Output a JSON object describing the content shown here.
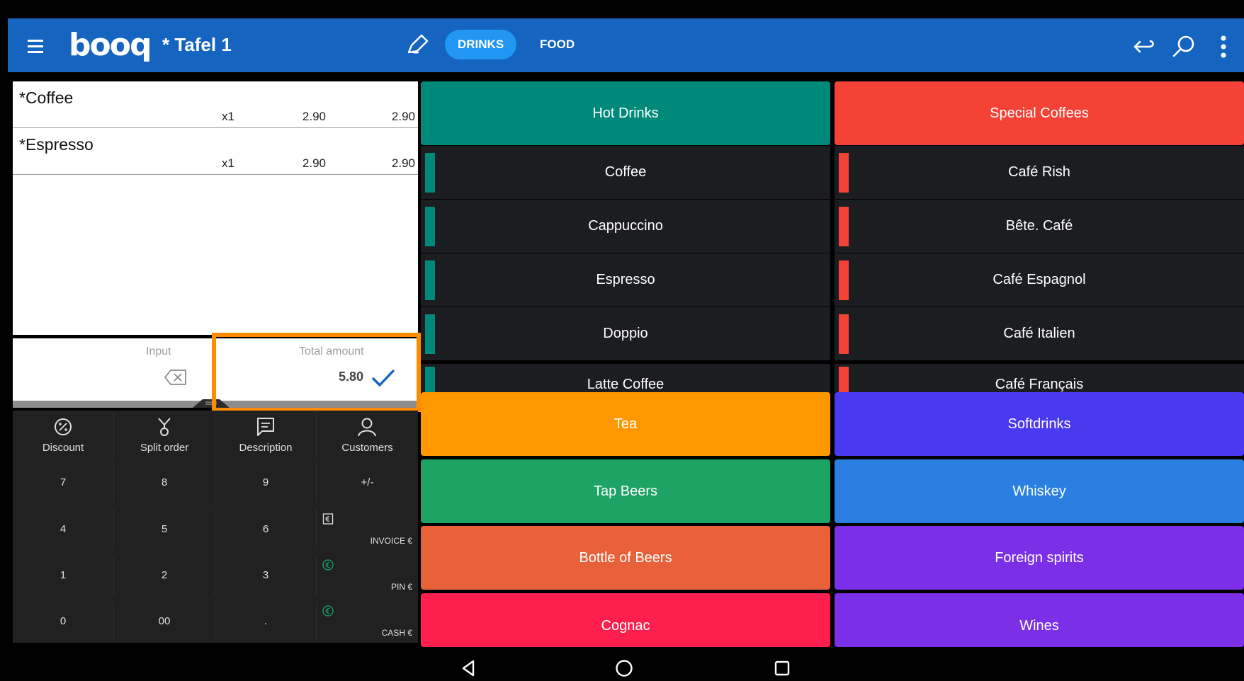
{
  "header": {
    "logo": "booq",
    "table_title": "* Tafel 1",
    "tabs": [
      {
        "label": "DRINKS",
        "active": true
      },
      {
        "label": "FOOD",
        "active": false
      }
    ],
    "bar_color": "#1565c0",
    "active_tab_color": "#2196f3"
  },
  "order": {
    "lines": [
      {
        "name": "*Coffee",
        "qty": "x1",
        "price": "2.90",
        "total": "2.90"
      },
      {
        "name": "*Espresso",
        "qty": "x1",
        "price": "2.90",
        "total": "2.90"
      }
    ]
  },
  "input": {
    "input_label": "Input",
    "total_label": "Total amount",
    "total_value": "5.80"
  },
  "actions": [
    {
      "label": "Discount",
      "icon": "discount-icon"
    },
    {
      "label": "Split order",
      "icon": "split-icon"
    },
    {
      "label": "Description",
      "icon": "description-icon"
    },
    {
      "label": "Customers",
      "icon": "customer-icon"
    }
  ],
  "keypad": {
    "rows": [
      [
        "7",
        "8",
        "9",
        "+/-"
      ],
      [
        "4",
        "5",
        "6"
      ],
      [
        "1",
        "2",
        "3"
      ],
      [
        "0",
        "00",
        "."
      ]
    ],
    "payments": [
      {
        "label": "INVOICE €",
        "icon": "invoice-icon"
      },
      {
        "label": "PIN €",
        "icon": "euro-icon"
      },
      {
        "label": "CASH €",
        "icon": "euro-icon"
      }
    ]
  },
  "categories_top": [
    {
      "label": "Hot Drinks",
      "color": "#00897b"
    },
    {
      "label": "Special Coffees",
      "color": "#f44336"
    }
  ],
  "products_left": [
    {
      "label": "Coffee",
      "stripe": "#00897b"
    },
    {
      "label": "Cappuccino",
      "stripe": "#00897b"
    },
    {
      "label": "Espresso",
      "stripe": "#00897b"
    },
    {
      "label": "Doppio",
      "stripe": "#00897b"
    },
    {
      "label": "Latte Coffee",
      "stripe": "#00897b"
    }
  ],
  "products_right": [
    {
      "label": "Café Rish",
      "stripe": "#f44336"
    },
    {
      "label": "Bête. Café",
      "stripe": "#f44336"
    },
    {
      "label": "Café Espagnol",
      "stripe": "#f44336"
    },
    {
      "label": "Café Italien",
      "stripe": "#f44336"
    },
    {
      "label": "Café Français",
      "stripe": "#f44336"
    }
  ],
  "categories": [
    {
      "left": {
        "label": "Tea",
        "color": "#ff9800"
      },
      "right": {
        "label": "Softdrinks",
        "color": "#4a3aef"
      }
    },
    {
      "left": {
        "label": "Tap Beers",
        "color": "#1da363"
      },
      "right": {
        "label": "Whiskey",
        "color": "#2a80e0"
      }
    },
    {
      "left": {
        "label": "Bottle of Beers",
        "color": "#e8613a"
      },
      "right": {
        "label": "Foreign spirits",
        "color": "#7b2fe6"
      }
    },
    {
      "left": {
        "label": "Cognac",
        "color": "#ff1f4f"
      },
      "right": {
        "label": "Wines",
        "color": "#7b2fe6"
      }
    }
  ],
  "highlight_color": "#ff8c00"
}
